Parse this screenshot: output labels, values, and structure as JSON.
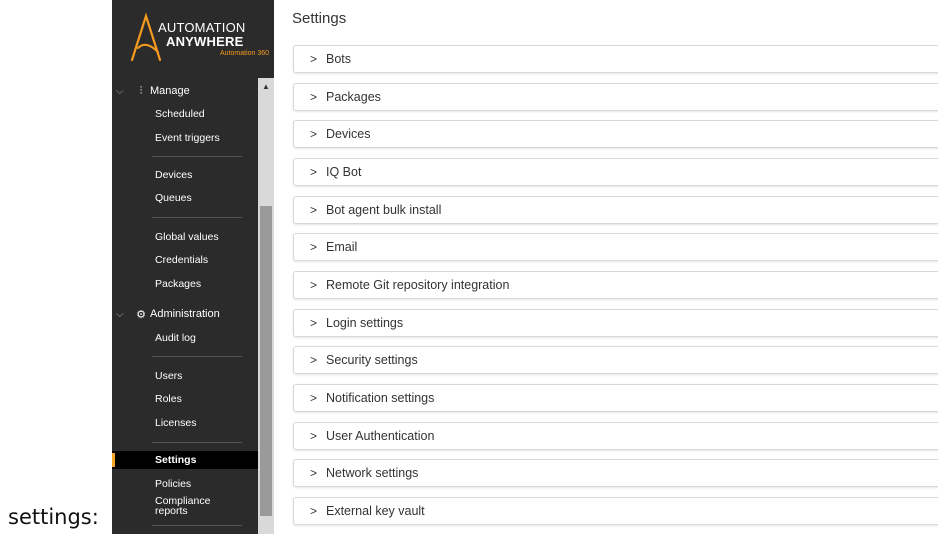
{
  "caption": "settings:",
  "logo": {
    "line1": "AUTOMATION",
    "line2": "ANYWHERE",
    "line3": "Automation 360",
    "accent_color": "#f49a1f"
  },
  "sidebar": {
    "groups": [
      {
        "label": "Manage",
        "icon": "sliders-icon",
        "chevron": "⌵"
      },
      {
        "label": "Administration",
        "icon": "gear-icon",
        "chevron": "⌵"
      }
    ],
    "items": [
      {
        "label": "Scheduled"
      },
      {
        "label": "Event triggers"
      },
      {
        "label": "Devices"
      },
      {
        "label": "Queues"
      },
      {
        "label": "Global values"
      },
      {
        "label": "Credentials"
      },
      {
        "label": "Packages"
      },
      {
        "label": "Audit log"
      },
      {
        "label": "Users"
      },
      {
        "label": "Roles"
      },
      {
        "label": "Licenses"
      },
      {
        "label": "Settings",
        "active": true
      },
      {
        "label": "Policies"
      },
      {
        "label": "Compliance reports"
      }
    ],
    "active_color": "#f5a623"
  },
  "main": {
    "title": "Settings",
    "chevron": ">",
    "sections": [
      {
        "label": "Bots"
      },
      {
        "label": "Packages"
      },
      {
        "label": "Devices"
      },
      {
        "label": "IQ Bot"
      },
      {
        "label": "Bot agent bulk install"
      },
      {
        "label": "Email"
      },
      {
        "label": "Remote Git repository integration"
      },
      {
        "label": "Login settings"
      },
      {
        "label": "Security settings"
      },
      {
        "label": "Notification settings"
      },
      {
        "label": "User Authentication"
      },
      {
        "label": "Network settings"
      },
      {
        "label": "External key vault"
      }
    ]
  }
}
